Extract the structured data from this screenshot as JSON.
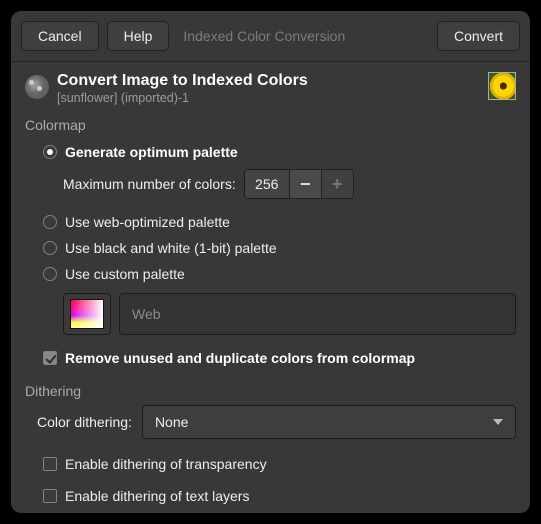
{
  "toolbar": {
    "cancel": "Cancel",
    "help": "Help",
    "title": "Indexed Color Conversion",
    "convert": "Convert"
  },
  "header": {
    "title": "Convert Image to Indexed Colors",
    "subtitle": "[sunflower] (imported)-1"
  },
  "colormap": {
    "section_label": "Colormap",
    "generate_optimum": "Generate optimum palette",
    "max_colors_label": "Maximum number of colors:",
    "max_colors_value": "256",
    "web_optimized": "Use web-optimized palette",
    "bw_palette": "Use black and white (1-bit) palette",
    "custom_palette": "Use custom palette",
    "custom_palette_name": "Web",
    "remove_unused": "Remove unused and duplicate colors from colormap"
  },
  "dithering": {
    "section_label": "Dithering",
    "color_dithering_label": "Color dithering:",
    "color_dithering_value": "None",
    "enable_transparency": "Enable dithering of transparency",
    "enable_text_layers": "Enable dithering of text layers"
  }
}
